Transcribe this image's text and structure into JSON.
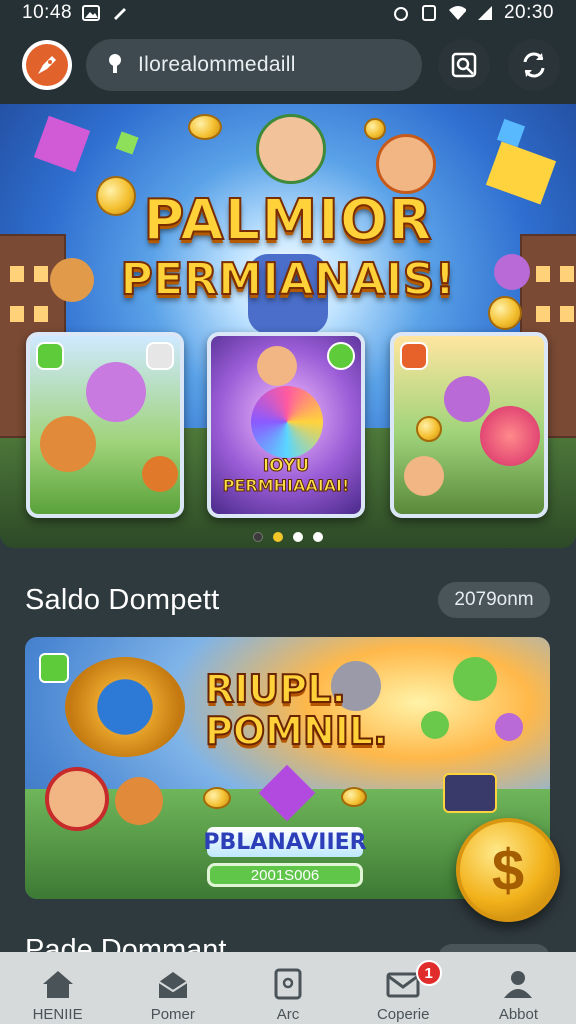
{
  "status_bar": {
    "time_left": "10:48",
    "time_right": "20:30"
  },
  "app_bar": {
    "search_text": "Ilorealommedaill"
  },
  "hero": {
    "title_line1": "PALMIOR",
    "title_line2": "PERMIANAIS!",
    "card_middle_caption_1": "IOYU",
    "card_middle_caption_2": "PERMHIAAIAI!",
    "carousel": {
      "total": 4,
      "active": 2
    }
  },
  "section": {
    "title": "Saldo Dompett",
    "pill": "2079onm"
  },
  "promo_banner": {
    "title_line1": "RIUPL.",
    "title_line2": "POMNIL.",
    "label": "PBLANAVIIER",
    "bar_text": "2001S006",
    "coin_symbol": "$"
  },
  "next_section": {
    "title": "Pade Dommant"
  },
  "bottom_nav": {
    "items": [
      {
        "label": "HENIIE",
        "icon": "home-icon"
      },
      {
        "label": "Pomer",
        "icon": "mail-open-icon"
      },
      {
        "label": "Arc",
        "icon": "tablet-icon"
      },
      {
        "label": "Coperie",
        "icon": "inbox-icon",
        "badge": "1"
      },
      {
        "label": "Abbot",
        "icon": "user-icon"
      }
    ]
  },
  "colors": {
    "background": "#2f3a3f",
    "app_bar": "#263136",
    "accent_orange": "#e2622c",
    "title_gold": "#ffd23a",
    "nav_bg": "#d7dadb",
    "badge_red": "#e12c2c"
  }
}
